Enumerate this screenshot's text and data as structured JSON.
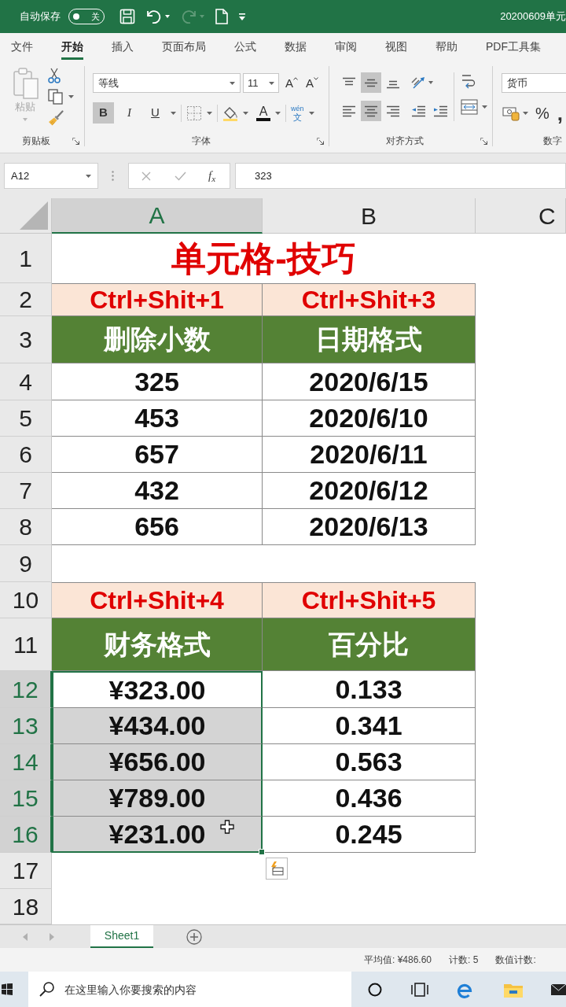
{
  "title_bar": {
    "autosave": {
      "label": "自动保存",
      "state": "关",
      "on": false
    },
    "quick_access": [
      {
        "kind": "save",
        "disabled": false
      },
      {
        "kind": "undo",
        "disabled": false
      },
      {
        "kind": "redo",
        "disabled": true
      },
      {
        "kind": "new",
        "disabled": false
      },
      {
        "kind": "customize",
        "disabled": false
      }
    ],
    "title": "20200609单元"
  },
  "ribbon_tabs": [
    {
      "label": "文件",
      "selected": false
    },
    {
      "label": "开始",
      "selected": true
    },
    {
      "label": "插入",
      "selected": false
    },
    {
      "label": "页面布局",
      "selected": false
    },
    {
      "label": "公式",
      "selected": false
    },
    {
      "label": "数据",
      "selected": false
    },
    {
      "label": "审阅",
      "selected": false
    },
    {
      "label": "视图",
      "selected": false
    },
    {
      "label": "帮助",
      "selected": false
    },
    {
      "label": "PDF工具集",
      "selected": false
    }
  ],
  "ribbon": {
    "clipboard": {
      "paste": {
        "label": "粘贴",
        "disabled": true
      },
      "label": "剪贴板"
    },
    "font": {
      "name": "等线",
      "size": "11",
      "grow": "A",
      "shrink": "A",
      "styles": [
        {
          "kind": "bold",
          "label": "B",
          "pressed": true
        },
        {
          "kind": "italic",
          "label": "I",
          "pressed": false
        },
        {
          "kind": "underline",
          "label": "U",
          "pressed": false
        }
      ],
      "font_color": "A",
      "phonetic": {
        "ruby": "wén",
        "base": "文"
      },
      "label": "字体"
    },
    "alignment": {
      "vertical": [
        {
          "kind": "top",
          "pressed": false
        },
        {
          "kind": "middle",
          "pressed": true
        },
        {
          "kind": "bottom",
          "pressed": false
        }
      ],
      "horizontal": [
        {
          "kind": "left",
          "pressed": false
        },
        {
          "kind": "center",
          "pressed": true
        },
        {
          "kind": "right",
          "pressed": false
        }
      ],
      "label": "对齐方式"
    },
    "number": {
      "format": "货币",
      "percent": "%",
      "comma": ",",
      "label": "数字"
    }
  },
  "formula_bar": {
    "name_box": "A12",
    "function_label": "f$_{x}$",
    "formula": "323"
  },
  "sheet": {
    "columns": [
      {
        "label": "A",
        "selected": true
      },
      {
        "label": "B",
        "selected": false
      },
      {
        "label": "C",
        "selected": false
      }
    ],
    "rows": [
      {
        "number": "1",
        "selected": false,
        "kind": "title",
        "cells": [
          {
            "text": "单元格-技巧",
            "selected": false,
            "active": false
          }
        ]
      },
      {
        "number": "2",
        "selected": false,
        "kind": "shortcut",
        "cells": [
          {
            "text": "Ctrl+Shit+1",
            "selected": false,
            "active": false
          },
          {
            "text": "Ctrl+Shit+3",
            "selected": false,
            "active": false
          }
        ]
      },
      {
        "number": "3",
        "selected": false,
        "kind": "header",
        "cells": [
          {
            "text": "删除小数",
            "selected": false,
            "active": false
          },
          {
            "text": "日期格式",
            "selected": false,
            "active": false
          }
        ]
      },
      {
        "number": "4",
        "selected": false,
        "kind": "data",
        "cells": [
          {
            "text": "325",
            "selected": false,
            "active": false
          },
          {
            "text": "2020/6/15",
            "selected": false,
            "active": false
          }
        ]
      },
      {
        "number": "5",
        "selected": false,
        "kind": "data",
        "cells": [
          {
            "text": "453",
            "selected": false,
            "active": false
          },
          {
            "text": "2020/6/10",
            "selected": false,
            "active": false
          }
        ]
      },
      {
        "number": "6",
        "selected": false,
        "kind": "data",
        "cells": [
          {
            "text": "657",
            "selected": false,
            "active": false
          },
          {
            "text": "2020/6/11",
            "selected": false,
            "active": false
          }
        ]
      },
      {
        "number": "7",
        "selected": false,
        "kind": "data",
        "cells": [
          {
            "text": "432",
            "selected": false,
            "active": false
          },
          {
            "text": "2020/6/12",
            "selected": false,
            "active": false
          }
        ]
      },
      {
        "number": "8",
        "selected": false,
        "kind": "data",
        "cells": [
          {
            "text": "656",
            "selected": false,
            "active": false
          },
          {
            "text": "2020/6/13",
            "selected": false,
            "active": false
          }
        ]
      },
      {
        "number": "9",
        "selected": false,
        "kind": "empty"
      },
      {
        "number": "10",
        "selected": false,
        "kind": "shortcut",
        "cells": [
          {
            "text": "Ctrl+Shit+4",
            "selected": false,
            "active": false
          },
          {
            "text": "Ctrl+Shit+5",
            "selected": false,
            "active": false
          }
        ]
      },
      {
        "number": "11",
        "selected": false,
        "kind": "header",
        "cells": [
          {
            "text": "财务格式",
            "selected": false,
            "active": false
          },
          {
            "text": "百分比",
            "selected": false,
            "active": false
          }
        ]
      },
      {
        "number": "12",
        "selected": true,
        "kind": "data",
        "cells": [
          {
            "text": "¥323.00",
            "selected": true,
            "active": true
          },
          {
            "text": "0.133",
            "selected": false,
            "active": false
          }
        ]
      },
      {
        "number": "13",
        "selected": true,
        "kind": "data",
        "cells": [
          {
            "text": "¥434.00",
            "selected": true,
            "active": false
          },
          {
            "text": "0.341",
            "selected": false,
            "active": false
          }
        ]
      },
      {
        "number": "14",
        "selected": true,
        "kind": "data",
        "cells": [
          {
            "text": "¥656.00",
            "selected": true,
            "active": false
          },
          {
            "text": "0.563",
            "selected": false,
            "active": false
          }
        ]
      },
      {
        "number": "15",
        "selected": true,
        "kind": "data",
        "cells": [
          {
            "text": "¥789.00",
            "selected": true,
            "active": false
          },
          {
            "text": "0.436",
            "selected": false,
            "active": false
          }
        ]
      },
      {
        "number": "16",
        "selected": true,
        "kind": "data",
        "cells": [
          {
            "text": "¥231.00",
            "selected": true,
            "active": false
          },
          {
            "text": "0.245",
            "selected": false,
            "active": false
          }
        ]
      },
      {
        "number": "17",
        "selected": false,
        "kind": "empty"
      },
      {
        "number": "18",
        "selected": false,
        "kind": "empty"
      }
    ]
  },
  "sheet_tabs": [
    {
      "label": "Sheet1",
      "selected": true
    }
  ],
  "status_bar": [
    "平均值: ¥486.60",
    "计数: 5",
    "数值计数:"
  ],
  "taskbar": {
    "search": {
      "placeholder": "在这里输入你要搜索的内容"
    }
  }
}
